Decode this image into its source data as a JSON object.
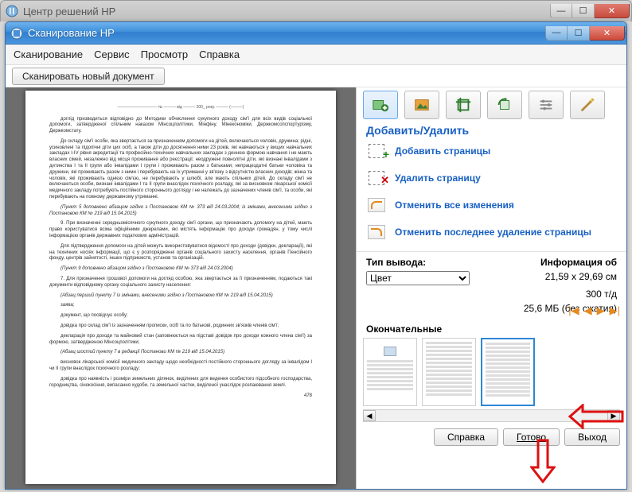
{
  "outer_window": {
    "title": "Центр решений HP"
  },
  "inner_window": {
    "title": "Сканирование HP"
  },
  "menu": {
    "scan": "Сканирование",
    "service": "Сервис",
    "view": "Просмотр",
    "help": "Справка"
  },
  "toolbar": {
    "scan_new": "Сканировать новый документ"
  },
  "section_title": "Добавить/Удалить",
  "actions": {
    "add_pages": "Добавить страницы",
    "delete_page": "Удалить страницу",
    "undo_all": "Отменить все изменения",
    "redo_last": "Отменить последнее удаление страницы"
  },
  "props": {
    "output_type_label": "Тип вывода:",
    "output_type_value": "Цвет",
    "info_label": "Информация об",
    "dims": "21,59 x 29,69 см",
    "dpi": "300 т/д",
    "size": "25,6 МБ (без сжатия)"
  },
  "final_label": "Окончательные",
  "footer": {
    "help": "Справка",
    "done": "Готово",
    "exit": "Выход"
  },
  "doc": {
    "header": "—————————— № ——— від ——— 200_ року. ——— (———)",
    "p0": "доглід призводиться відповідно до Методики обчислення сукупного доходу сім'ї для всіх видів соціальної допомоги, затвердженої спільним наказом Мінсоцполітики, Мінфіну, Мінекономіки, Держкомсопспортурізму, Держкомстату.",
    "p1": "До складу сім'ї особи, яка звертається за призначенням допомоги на дітей, включаються чоловік, дружина; рідні, усиновлені та підопічні діти цих осіб, а також діти до досягнення ними 23 років, які навчаються у вищих навчальних закладах I-IV рівня акредитації та професійно-технічних навчальних закладах з денною формою навчання і не мають власних сімей, незалежно від місця проживання або реєстрації; неодружені повнолітні діти, які визнані інвалідами з дитинства І та ІІ групи або інвалідами І групи і проживають разом з батьками; непрацездатні батьки чоловіка та дружини, які проживають разом з ними і перебувають на їх утриманні у зв'язку з відсутністю власних доходів; жінка та чоловік, які проживають однією сім'єю, не перебувають у шлюбі, але мають спільних дітей. До складу сім'ї не включаються особи, визнані інвалідами І та ІІ групи внаслідок психічного розладу, які за висновком лікарської комісії медичного закладу потребують постійного стороннього догляду і не належать до зазначених членів сім'ї, та особи, які перебувають на повному державному утриманні.",
    "p2it": "(Пункт 5 доповнено абзацом згідно з Постановою КМ № 373 від 24.03.2004; із змінами, внесеними згідно з Постановою КМ № 219 від 15.04.2015)",
    "p3": "9. При визначенні середньомісячного сукупного доходу сім'ї органи, що призначають допомогу на дітей, мають право користуватися всіма офіційними джерелами, які містять інформацію про доходи громадян, у тому числі інформацією органів державних податкових адміністрацій.",
    "p4": "Для підтвердження допомоги на дітей можуть використовуватися відомості про доходи (довідки, декларації), які на технічних носіях інформації, що є у розпорядженні органів соціального захисту населення, органів Пенсійного фонду, центрів зайнятості, інших підприємств, установ та організацій.",
    "p5it": "(Пункт 9 доповнено абзацом згідно з Постановою КМ № 373 від 24.03.2004)",
    "p6": "7. Для призначення грошової допомоги на догляд особою, яка звертається за її призначенням, подаються такі документи відповідному органу соціального захисту населення:",
    "p7it": "(Абзац перший пункту 7 із змінами, внесеними згідно з Постановою КМ № 219 від 15.04.2015)",
    "p8": "заява;",
    "p9": "документ, що посвідчує особу;",
    "p10": "довідка про склад сім'ї із зазначенням прописки, осіб та по батькові, родинних зв'язків членів сім'ї;",
    "p11": "декларація про доходи та майновий стан (заповнюється на підставі довідок про доходи кожного члена сім'ї) за формою, затвердженою Мінсоцполітики;",
    "p12it": "(Абзац шостий пункту 7 в редакції Постанови КМ № 219 від 15.04.2015)",
    "p13": "висновок лікарської комісії медичного закладу щодо необхідності постійного стороннього догляду за інвалідом І чи ІІ групи внаслідок психічного розладу;",
    "p14": "довідка про наявність і розміри земельних ділянок, виділених для ведення особистого підсобного господарства, городництва, сінокосіння, випасання худоби, та земельної частки, виділеної унаслідок розпаювання землі.",
    "pg": "478"
  }
}
